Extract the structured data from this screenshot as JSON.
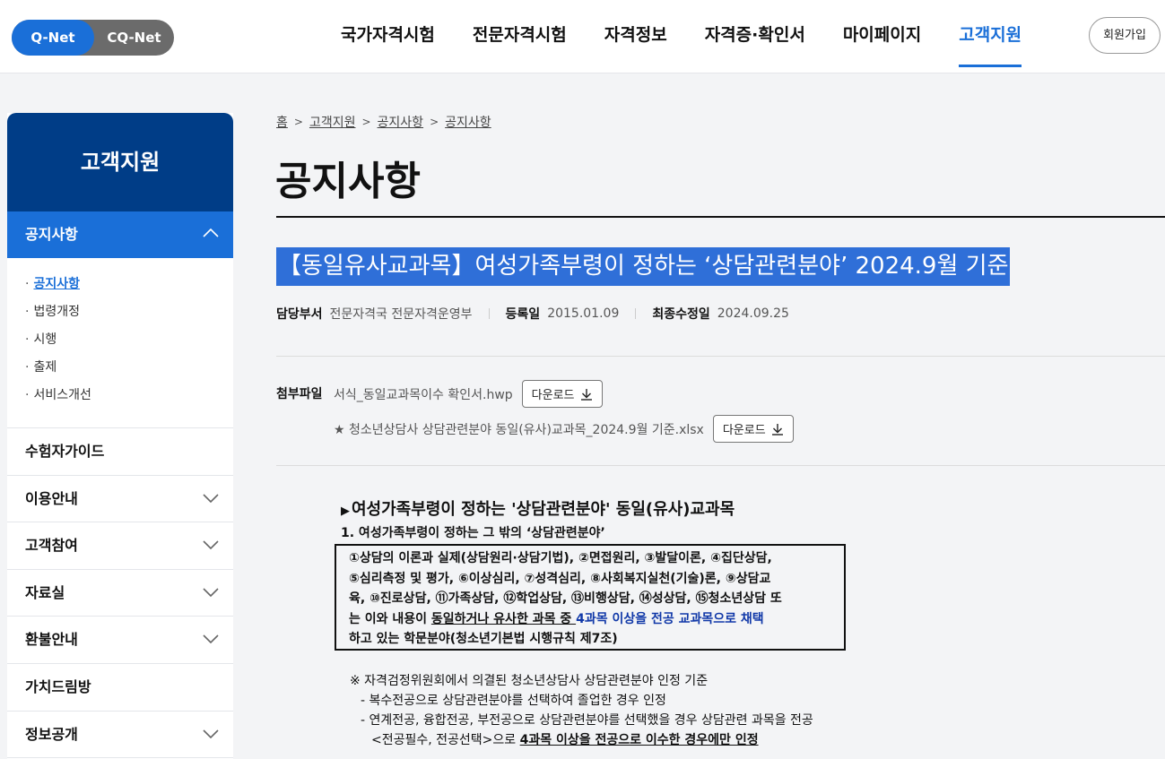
{
  "header": {
    "qnet_label": "Q-Net",
    "cqnet_label": "CQ-Net",
    "nav": [
      "국가자격시험",
      "전문자격시험",
      "자격정보",
      "자격증·확인서",
      "마이페이지",
      "고객지원"
    ],
    "join_label": "회원가입",
    "accent_color": "#1a6fd8"
  },
  "sidebar": {
    "title": "고객지원",
    "active_menu": "공지사항",
    "sub_items": [
      "공지사항",
      "법령개정",
      "시행",
      "출제",
      "서비스개선"
    ],
    "menus": [
      "수험자가이드",
      "이용안내",
      "고객참여",
      "자료실",
      "환불안내",
      "가치드림방",
      "정보공개"
    ]
  },
  "breadcrumb": [
    "홈",
    "고객지원",
    "공지사항",
    "공지사항"
  ],
  "page_title": "공지사항",
  "post": {
    "title": "【동일유사교과목】여성가족부령이 정하는 ‘상담관련분야’ 2024.9월 기준",
    "dept_label": "담당부서",
    "dept_value": "전문자격국 전문자격운영부",
    "reg_label": "등록일",
    "reg_value": "2015.01.09",
    "mod_label": "최종수정일",
    "mod_value": "2024.09.25",
    "attach_label": "첨부파일",
    "files": [
      {
        "name": "서식_동일교과목이수 확인서.hwp",
        "button": "다운로드"
      },
      {
        "name": "★ 청소년상담사 상담관련분야 동일(유사)교과목_2024.9월 기준.xlsx",
        "button": "다운로드"
      }
    ]
  },
  "content": {
    "section_title": "여성가족부령이 정하는 '상담관련분야' 동일(유사)교과목",
    "sub_title": "1. 여성가족부령이 정하는 그 밖의 ‘상담관련분야’",
    "box_line1": "①상담의 이론과 실제(상담원리·상담기법), ②면접원리, ③발달이론, ④집단상담,",
    "box_line2": "⑤심리측정 및 평가, ⑥이상심리, ⑦성격심리, ⑧사회복지실천(기술)론, ⑨상담교",
    "box_line3": "육, ⑩진로상담, ⑪가족상담, ⑫학업상담, ⑬비행상담, ⑭성상담, ⑮청소년상담 또",
    "box_line4_a": "는 이와 내용이 ",
    "box_line4_b": "동일하거나 유사한 과목 중 ",
    "box_line4_c": "4과목 이상을 전공 교과목으로 채택",
    "box_line5": "하고 있는 학문분야(청소년기본법 시행규칙 제7조)",
    "note1": "※ 자격검정위원회에서 의결된 청소년상담사 상담관련분야 인정 기준",
    "note2": "- 복수전공으로 상담관련분야를 선택하여 졸업한 경우 인정",
    "note3": "- 연계전공, 융합전공, 부전공으로 상담관련분야를 선택했을 경우 상담관련 과목을 전공",
    "note4_a": "<전공필수, 전공선택>으로 ",
    "note4_b": "4과목 이상을 전공으로 이수한 경우에만 인정"
  }
}
